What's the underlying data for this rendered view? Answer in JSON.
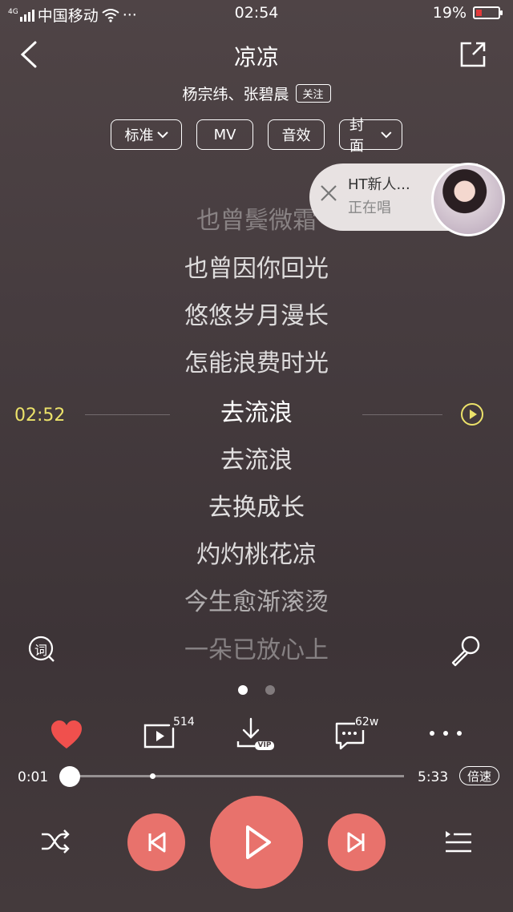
{
  "status_bar": {
    "network": "4G",
    "carrier": "中国移动",
    "more": "···",
    "time": "02:54",
    "battery_percent": "19%"
  },
  "header": {
    "title": "凉凉",
    "artist": "杨宗纬、张碧晨",
    "follow_label": "关注"
  },
  "chips": [
    {
      "label": "标准",
      "dropdown": true
    },
    {
      "label": "MV",
      "dropdown": false
    },
    {
      "label": "音效",
      "dropdown": false
    },
    {
      "label": "封面",
      "dropdown": true
    }
  ],
  "singing_popup": {
    "title": "HT新人...",
    "subtitle": "正在唱"
  },
  "lyrics": {
    "current_time": "02:52",
    "lines": [
      {
        "text": "也曾鬓微霜",
        "state": "faded"
      },
      {
        "text": "也曾因你回光",
        "state": "normal"
      },
      {
        "text": "悠悠岁月漫长",
        "state": "normal"
      },
      {
        "text": "怎能浪费时光",
        "state": "normal"
      },
      {
        "text": "去流浪",
        "state": "current"
      },
      {
        "text": "去流浪",
        "state": "normal"
      },
      {
        "text": "去换成长",
        "state": "normal"
      },
      {
        "text": "灼灼桃花凉",
        "state": "normal"
      },
      {
        "text": "今生愈渐滚烫",
        "state": "dim"
      },
      {
        "text": "一朵已放心上",
        "state": "faded"
      }
    ]
  },
  "lyrics_icon_label": "词",
  "pager": {
    "pages": 2,
    "active": 0
  },
  "actions": {
    "play_count": "514",
    "download_badge": "VIP",
    "comment_count": "62w"
  },
  "progress": {
    "elapsed": "0:01",
    "total": "5:33",
    "fraction": 0.003,
    "speed_label": "倍速"
  },
  "colors": {
    "accent": "#e8726c",
    "lyric_time": "#ece26a",
    "heart": "#f0504d"
  }
}
